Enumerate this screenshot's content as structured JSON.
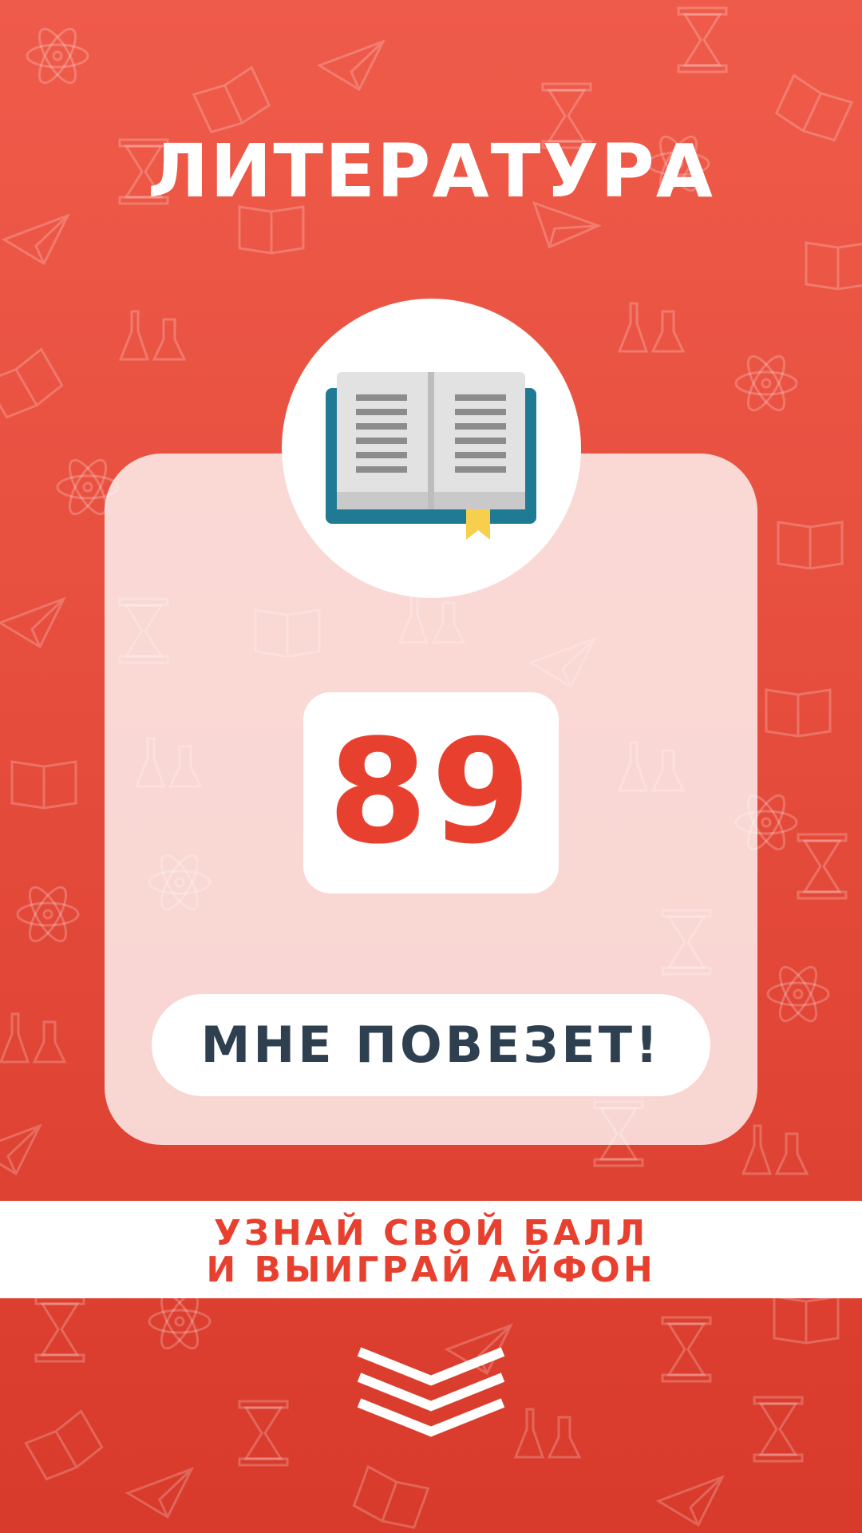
{
  "page": {
    "title": "ЛИТЕРАТУРА",
    "score": "89",
    "cta_label": "МНЕ ПОВЕЗЕТ!",
    "banner": {
      "line1": "УЗНАЙ СВОЙ БАЛЛ",
      "line2": "И ВЫИГРАЙ АЙФОН"
    }
  },
  "icons": {
    "subject_icon": "open-book-icon",
    "scroll_hint": "triple-chevron-down-icon",
    "background_pattern": [
      "atom-icon",
      "hourglass-icon",
      "paper-plane-icon",
      "book-icon",
      "flask-icon"
    ]
  },
  "colors": {
    "background_top": "#ef5b4a",
    "background_bottom": "#d83a2b",
    "accent_red": "#e8402f",
    "dark_text": "#2e3f50",
    "book_cover": "#1f7a94",
    "bookmark": "#f7cf4c"
  }
}
